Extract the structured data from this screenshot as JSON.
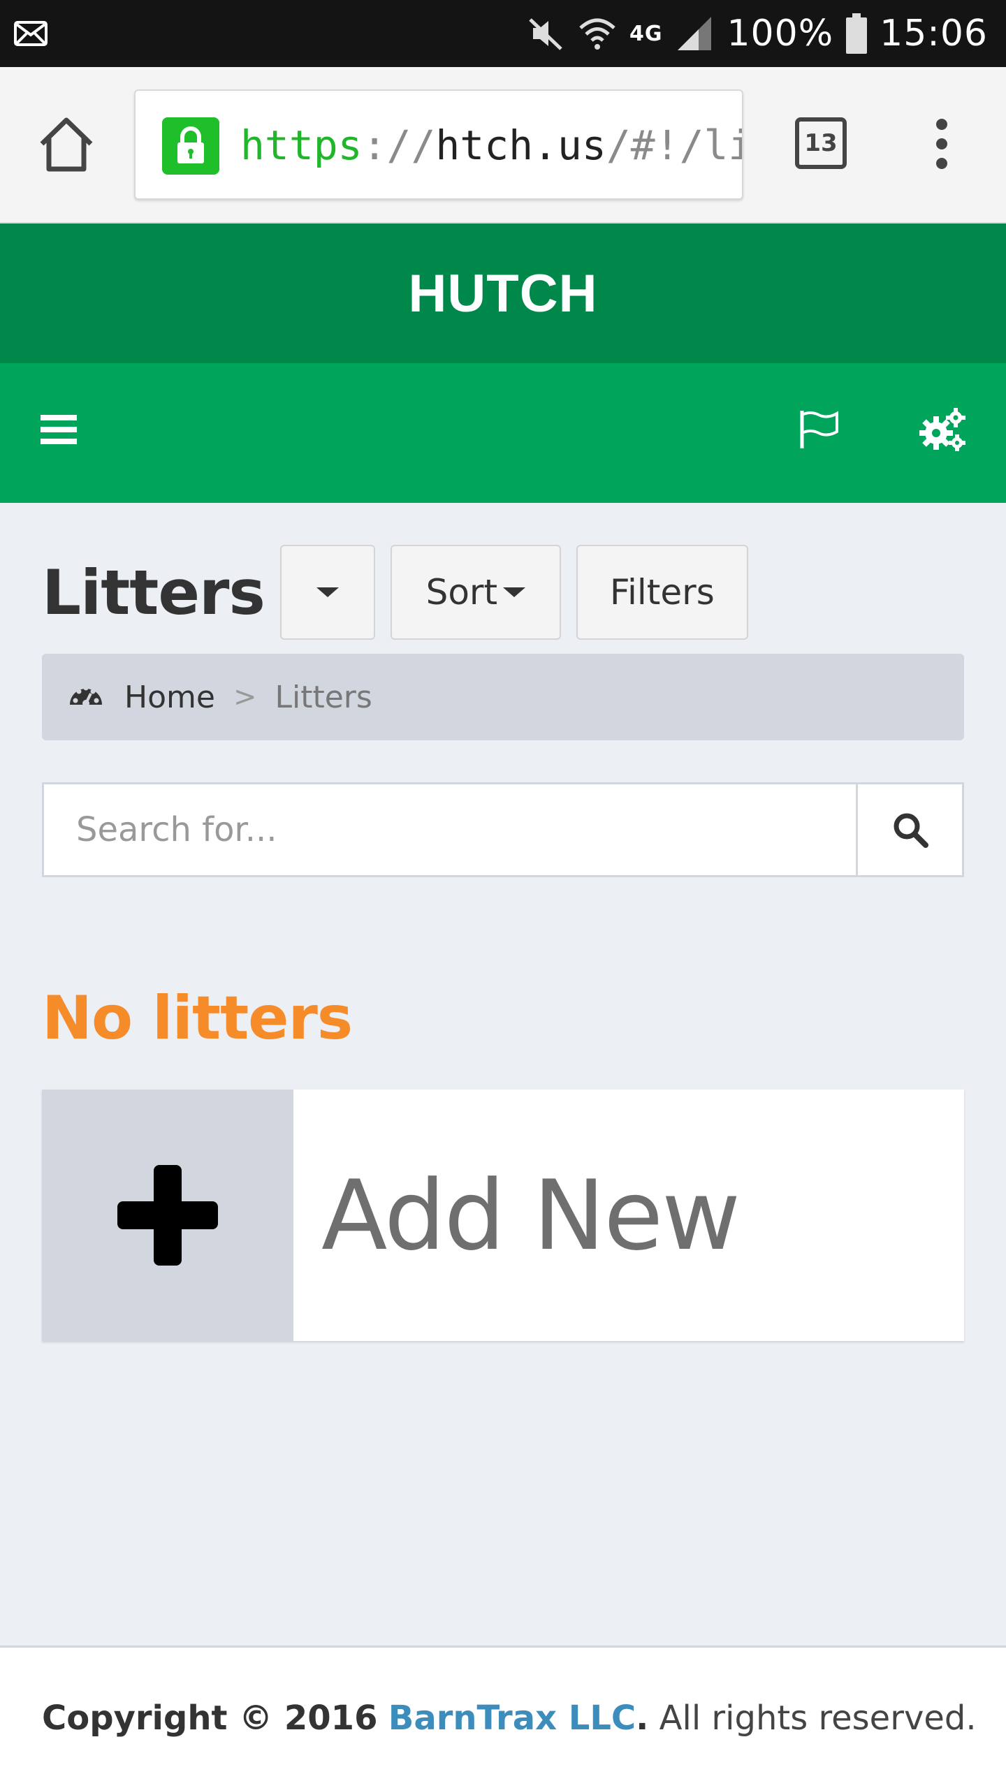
{
  "status_bar": {
    "battery": "100%",
    "time": "15:06",
    "network": "4G"
  },
  "browser": {
    "url_scheme": "https",
    "url_sep": "://",
    "url_host": "htch.us",
    "url_path": "/#!/litte",
    "tab_count": "13"
  },
  "app": {
    "title": "HUTCH"
  },
  "page": {
    "title": "Litters",
    "sort_label": "Sort",
    "filters_label": "Filters"
  },
  "breadcrumb": {
    "home": "Home",
    "separator": ">",
    "current": "Litters"
  },
  "search": {
    "placeholder": "Search for..."
  },
  "empty_state": {
    "message": "No litters"
  },
  "add_card": {
    "label": "Add New"
  },
  "footer": {
    "copyright": "Copyright © 2016",
    "brand": "BarnTrax LLC",
    "period": ".",
    "rights": " All rights reserved."
  },
  "colors": {
    "header_dark": "#00884a",
    "header_light": "#00a45a",
    "accent_orange": "#f68b2a",
    "link_blue": "#3c8dbc"
  }
}
